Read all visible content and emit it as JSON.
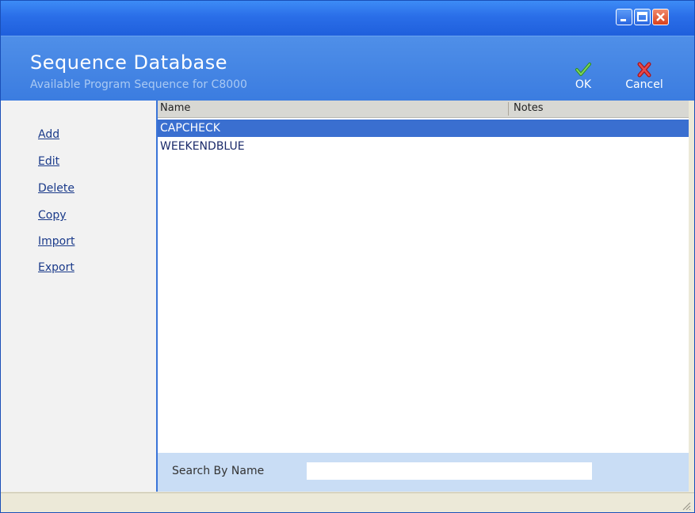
{
  "window": {
    "controls": {
      "minimize_icon": "minimize-icon",
      "maximize_icon": "maximize-icon",
      "close_icon": "close-icon"
    }
  },
  "header": {
    "title": "Sequence Database",
    "subtitle": "Available Program Sequence for C8000",
    "ok_label": "OK",
    "cancel_label": "Cancel",
    "ok_icon": "checkmark-icon",
    "cancel_icon": "x-mark-icon"
  },
  "sidebar": {
    "items": [
      "Add",
      "Edit",
      "Delete",
      "Copy",
      "Import",
      "Export"
    ]
  },
  "table": {
    "columns": [
      "Name",
      "Notes"
    ],
    "rows": [
      {
        "name": "CAPCHECK",
        "notes": "",
        "selected": true
      },
      {
        "name": "WEEKENDBLUE",
        "notes": "",
        "selected": false
      }
    ]
  },
  "search": {
    "label": "Search By Name",
    "value": ""
  },
  "colors": {
    "title_bar": "#2a6ee8",
    "header": "#3b7ce0",
    "selection": "#3a6fd0",
    "search_panel": "#c9ddf5"
  }
}
